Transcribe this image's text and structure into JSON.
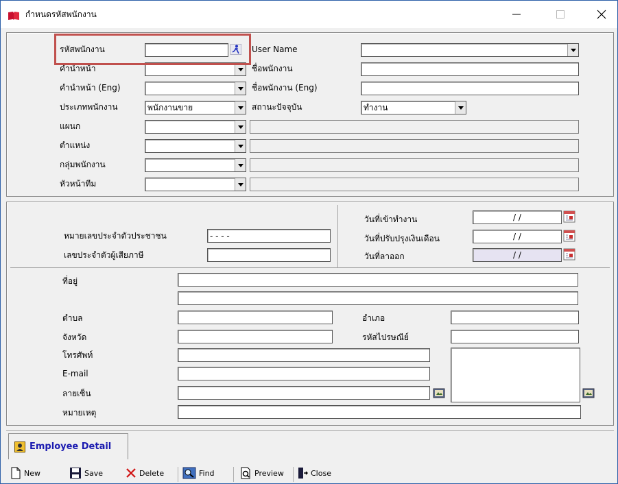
{
  "window": {
    "title": "กำหนดรหัสพนักงาน",
    "minimize_glyph": "—",
    "close_glyph": "✕"
  },
  "employee": {
    "code_label": "รหัสพนักงาน",
    "code_value": "",
    "username_label": "User Name",
    "username_value": "",
    "prefix_label": "คำนำหน้า",
    "prefix_value": "",
    "firstname_label": "ชื่อพนักงาน",
    "firstname_value": "",
    "prefix_eng_label": "คำนำหน้า (Eng)",
    "prefix_eng_value": "",
    "firstname_eng_label": "ชื่อพนักงาน (Eng)",
    "firstname_eng_value": "",
    "type_label": "ประเภทพนักงาน",
    "type_value": "พนักงานขาย",
    "status_label": "สถานะปัจจุบัน",
    "status_value": "ทำงาน",
    "dept_label": "แผนก",
    "position_label": "ตำแหน่ง",
    "group_label": "กลุ่มพนักงาน",
    "leader_label": "หัวหน้าทีม"
  },
  "identity": {
    "national_id_label": "หมายเลขประจำตัวประชาชน",
    "national_id_value": "-   -     -   -",
    "tax_id_label": "เลขประจำตัวผู้เสียภาษี",
    "tax_id_value": "",
    "start_date_label": "วันที่เข้าทำงาน",
    "start_date_value": "/ /",
    "salary_date_label": "วันที่ปรับปรุงเงินเดือน",
    "salary_date_value": "/ /",
    "resign_date_label": "วันที่ลาออก",
    "resign_date_value": "/ /"
  },
  "address": {
    "address_label": "ที่อยู่",
    "subdistrict_label": "ตำบล",
    "district_label": "อำเภอ",
    "province_label": "จังหวัด",
    "postcode_label": "รหัสไปรษณีย์",
    "phone_label": "โทรศัพท์",
    "email_label": "E-mail",
    "signature_label": "ลายเซ็น",
    "note_label": "หมายเหตุ"
  },
  "tabs": [
    {
      "label": "Employee Detail"
    }
  ],
  "toolbar": {
    "new_label": "New",
    "save_label": "Save",
    "delete_label": "Delete",
    "find_label": "Find",
    "preview_label": "Preview",
    "close_label": "Close"
  },
  "colors": {
    "highlight": "#c0504d",
    "tab_text": "#1a1ab0",
    "readonly_date": "#e6e3f2"
  }
}
